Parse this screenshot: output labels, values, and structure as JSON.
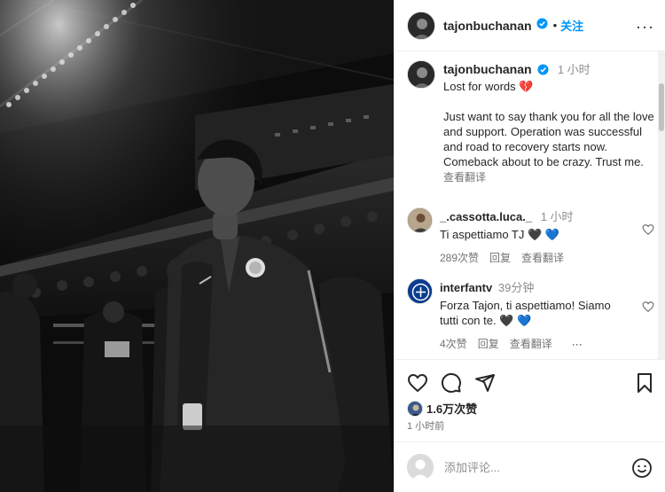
{
  "post": {
    "username": "tajonbuchanan",
    "follow_label": "关注",
    "more_label": "···"
  },
  "caption": {
    "username": "tajonbuchanan",
    "time": "1 小时",
    "line1": "Lost for words 💔",
    "body": "Just want to say thank you for all the love and support. Operation was successful and road to recovery starts now. Comeback about to be crazy. Trust me.",
    "translate": "查看翻译"
  },
  "comments": [
    {
      "username": "_.cassotta.luca._",
      "time": "1 小时",
      "text": "Ti aspettiamo TJ 🖤 💙",
      "likes": "289次赞",
      "reply": "回复",
      "translate": "查看翻译"
    },
    {
      "username": "interfantv",
      "time": "39分钟",
      "text": "Forza Tajon, ti aspettiamo! Siamo tutti con te. 🖤 💙",
      "likes": "4次赞",
      "reply": "回复",
      "translate": "查看翻译",
      "more": "···"
    }
  ],
  "likes": {
    "count": "1.6万次赞"
  },
  "timestamp": "1 小时前",
  "add_comment": {
    "placeholder": "添加评论..."
  },
  "colors": {
    "link": "#0095f6",
    "verified": "#0095f6",
    "text": "#262626",
    "muted": "#737373"
  },
  "icons": [
    "heart-icon",
    "comment-icon",
    "share-icon",
    "bookmark-icon",
    "emoji-icon",
    "more-icon",
    "verified-icon"
  ]
}
